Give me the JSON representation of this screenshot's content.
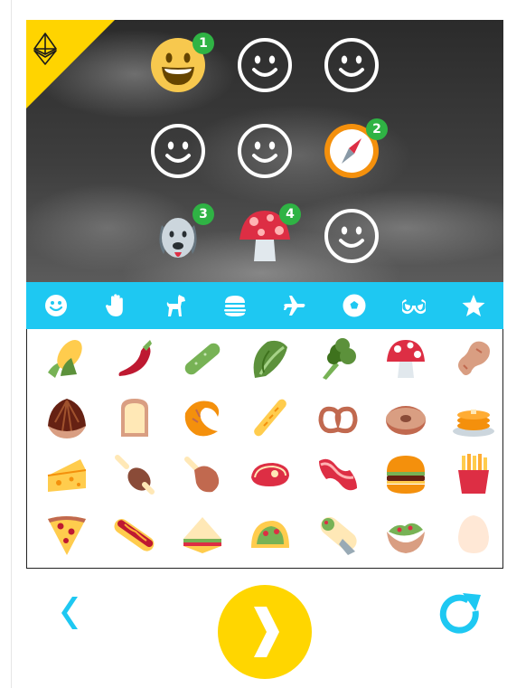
{
  "colors": {
    "accent_blue": "#1ec8f2",
    "accent_yellow": "#ffd600",
    "badge_green": "#2fb344"
  },
  "hero": {
    "badge_icon": "ethereum-icon",
    "slots": [
      {
        "icon": "grinning-face-emoji",
        "badge": "1"
      },
      {
        "icon": "smiley-outline-icon"
      },
      {
        "icon": "smiley-outline-icon"
      },
      {
        "icon": "smiley-outline-icon"
      },
      {
        "icon": "smiley-outline-icon"
      },
      {
        "icon": "compass-emoji",
        "badge": "2"
      },
      {
        "icon": "dog-face-emoji",
        "badge": "3"
      },
      {
        "icon": "mushroom-emoji",
        "badge": "4"
      },
      {
        "icon": "smiley-outline-icon"
      }
    ]
  },
  "categories": [
    "smileys-icon",
    "hand-icon",
    "dog-icon",
    "burger-icon",
    "airplane-icon",
    "soccer-ball-icon",
    "glasses-icon",
    "star-icon"
  ],
  "food_grid": [
    [
      "corn",
      "hot-pepper",
      "cucumber",
      "lettuce",
      "broccoli",
      "mushroom",
      "peanut"
    ],
    [
      "chestnut",
      "bread",
      "croissant",
      "baguette",
      "pretzel",
      "bagel",
      "pancakes"
    ],
    [
      "cheese",
      "meat-on-bone",
      "poultry-leg",
      "steak",
      "bacon",
      "hamburger",
      "fries"
    ],
    [
      "pizza",
      "hotdog",
      "sandwich",
      "taco",
      "burrito",
      "stuffed-flatbread",
      "egg"
    ]
  ],
  "controls": {
    "back": "chevron-left-icon",
    "next": "chevron-right-icon",
    "refresh": "refresh-icon"
  }
}
